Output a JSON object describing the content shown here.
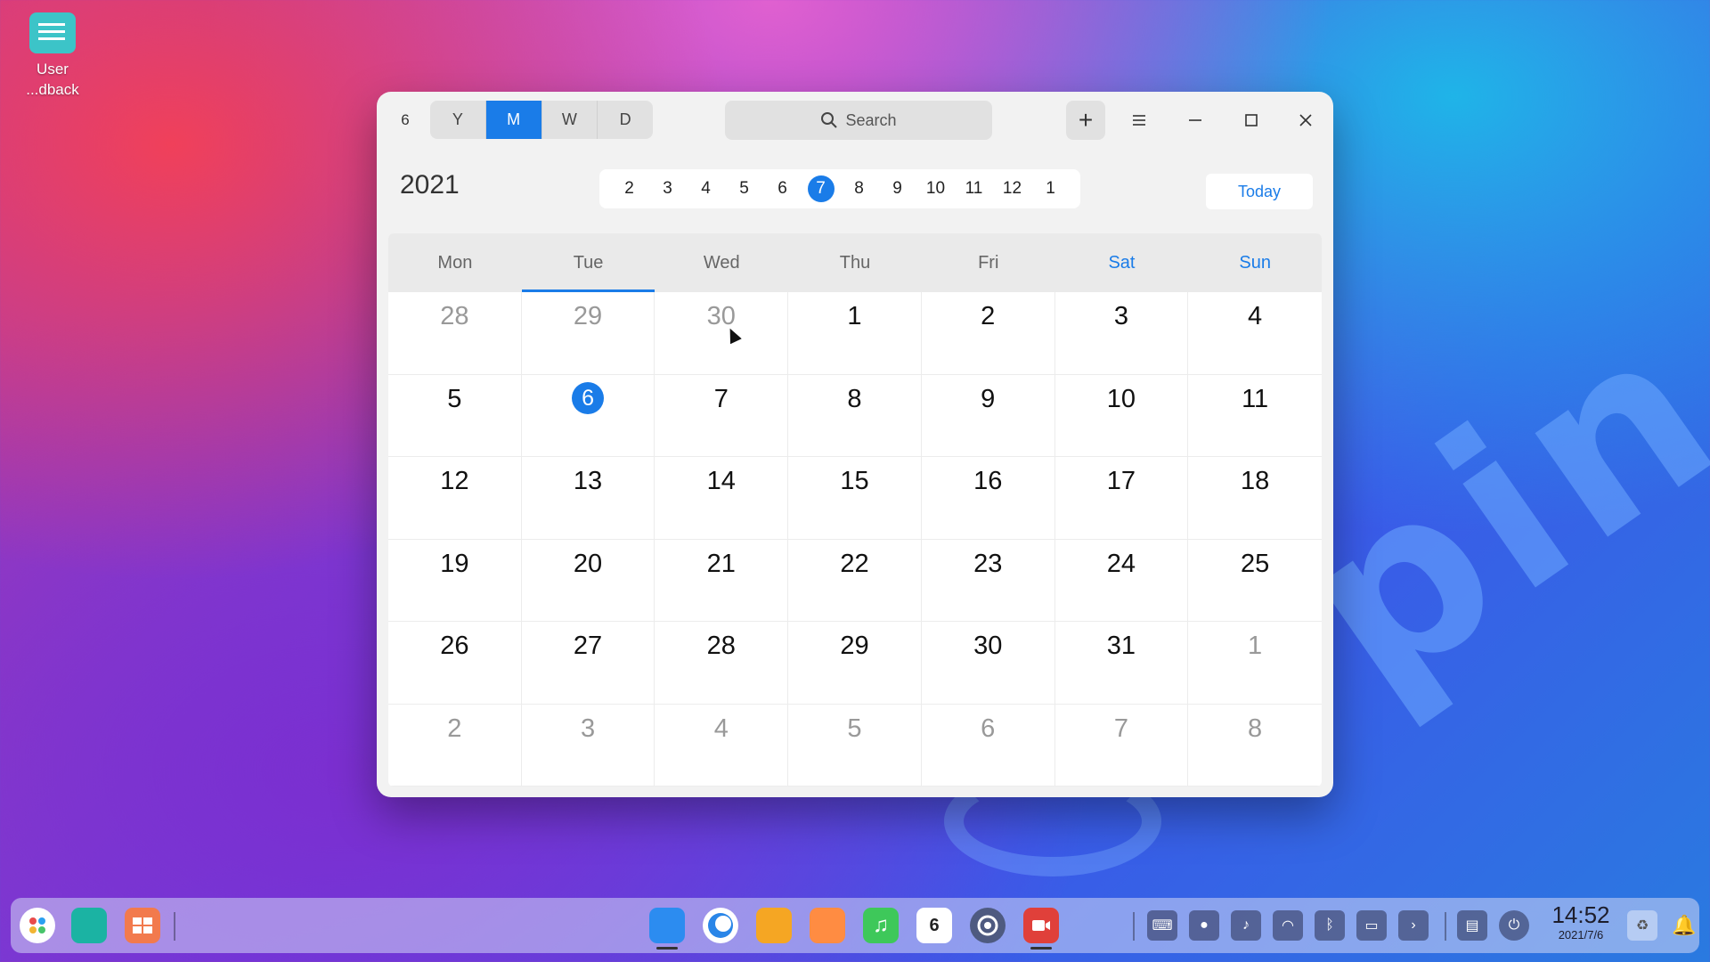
{
  "desktop": {
    "icon_label_line1": "User",
    "icon_label_line2": "...dback",
    "wallpaper_text": "pin"
  },
  "window": {
    "app_icon_text": "6",
    "views": [
      "Y",
      "M",
      "W",
      "D"
    ],
    "active_view": "M",
    "search_placeholder": "Search",
    "add_label": "+",
    "year": "2021",
    "months": [
      "2",
      "3",
      "4",
      "5",
      "6",
      "7",
      "8",
      "9",
      "10",
      "11",
      "12",
      "1"
    ],
    "current_month": "7",
    "today_label": "Today",
    "weekdays": [
      {
        "label": "Mon",
        "weekend": false,
        "today": false
      },
      {
        "label": "Tue",
        "weekend": false,
        "today": true
      },
      {
        "label": "Wed",
        "weekend": false,
        "today": false
      },
      {
        "label": "Thu",
        "weekend": false,
        "today": false
      },
      {
        "label": "Fri",
        "weekend": false,
        "today": false
      },
      {
        "label": "Sat",
        "weekend": true,
        "today": false
      },
      {
        "label": "Sun",
        "weekend": true,
        "today": false
      }
    ],
    "days": [
      {
        "n": "28",
        "other": true
      },
      {
        "n": "29",
        "other": true
      },
      {
        "n": "30",
        "other": true
      },
      {
        "n": "1"
      },
      {
        "n": "2"
      },
      {
        "n": "3"
      },
      {
        "n": "4"
      },
      {
        "n": "5"
      },
      {
        "n": "6",
        "today": true
      },
      {
        "n": "7"
      },
      {
        "n": "8"
      },
      {
        "n": "9"
      },
      {
        "n": "10"
      },
      {
        "n": "11"
      },
      {
        "n": "12"
      },
      {
        "n": "13"
      },
      {
        "n": "14"
      },
      {
        "n": "15"
      },
      {
        "n": "16"
      },
      {
        "n": "17"
      },
      {
        "n": "18"
      },
      {
        "n": "19"
      },
      {
        "n": "20"
      },
      {
        "n": "21"
      },
      {
        "n": "22"
      },
      {
        "n": "23"
      },
      {
        "n": "24"
      },
      {
        "n": "25"
      },
      {
        "n": "26"
      },
      {
        "n": "27"
      },
      {
        "n": "28"
      },
      {
        "n": "29"
      },
      {
        "n": "30"
      },
      {
        "n": "31"
      },
      {
        "n": "1",
        "other": true
      },
      {
        "n": "2",
        "other": true
      },
      {
        "n": "3",
        "other": true
      },
      {
        "n": "4",
        "other": true
      },
      {
        "n": "5",
        "other": true
      },
      {
        "n": "6",
        "other": true
      },
      {
        "n": "7",
        "other": true
      },
      {
        "n": "8",
        "other": true
      }
    ]
  },
  "taskbar": {
    "clock_time": "14:52",
    "clock_date": "2021/7/6",
    "calendar_icon_day": "6",
    "apps": [
      "launcher-icon",
      "file-manager-icon",
      "multitasking-icon",
      "app-store-icon",
      "browser-icon",
      "package-icon",
      "image-viewer-icon",
      "music-icon",
      "calendar-icon",
      "settings-icon",
      "screen-recorder-icon"
    ],
    "tray": [
      "keyboard-icon",
      "record-icon",
      "volume-icon",
      "wifi-icon",
      "bluetooth-icon",
      "battery-icon",
      "expand-arrow-icon",
      "onboard-keyboard-icon",
      "power-icon"
    ]
  },
  "colors": {
    "accent": "#1a7ce8"
  }
}
